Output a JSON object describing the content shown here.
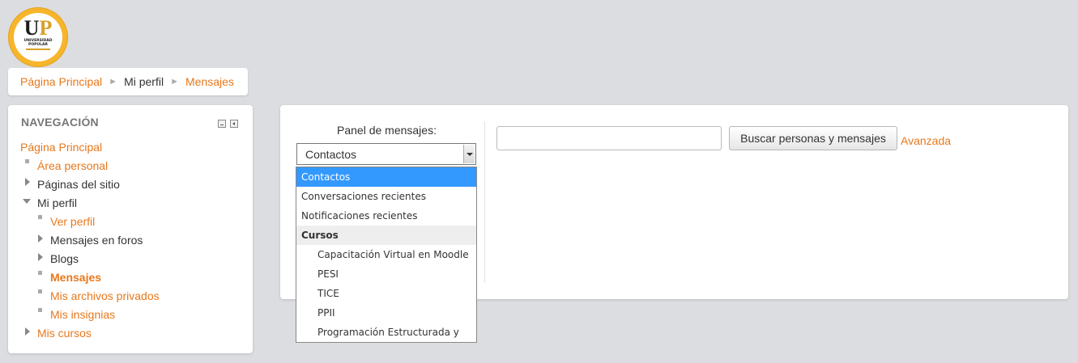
{
  "logo": {
    "mark_u": "U",
    "mark_p": "P",
    "text_line1": "UNIVERSIDAD",
    "text_line2": "POPULAR"
  },
  "breadcrumb": {
    "items": [
      "Página Principal",
      "Mi perfil",
      "Mensajes"
    ],
    "separator": "►"
  },
  "navigation": {
    "title": "NAVEGACIÓN",
    "items": [
      {
        "label": "Página Principal"
      },
      {
        "label": "Área personal"
      },
      {
        "label": "Páginas del sitio"
      },
      {
        "label": "Mi perfil"
      },
      {
        "label": "Ver perfil"
      },
      {
        "label": "Mensajes en foros"
      },
      {
        "label": "Blogs"
      },
      {
        "label": "Mensajes"
      },
      {
        "label": "Mis archivos privados"
      },
      {
        "label": "Mis insignias"
      },
      {
        "label": "Mis cursos"
      }
    ]
  },
  "messages": {
    "panel_label": "Panel de mensajes:",
    "selected": "Contactos",
    "options": [
      "Contactos",
      "Conversaciones recientes",
      "Notificaciones recientes",
      "Cursos",
      "Capacitación Virtual en Moodle",
      "PESI",
      "TICE",
      "PPII",
      "Programación Estructurada y"
    ],
    "search_value": "",
    "search_button": "Buscar personas y mensajes",
    "advanced_link": "Avanzada"
  },
  "colors": {
    "accent": "#e8781c",
    "selection": "#3399ff",
    "background": "#dcdde0"
  }
}
